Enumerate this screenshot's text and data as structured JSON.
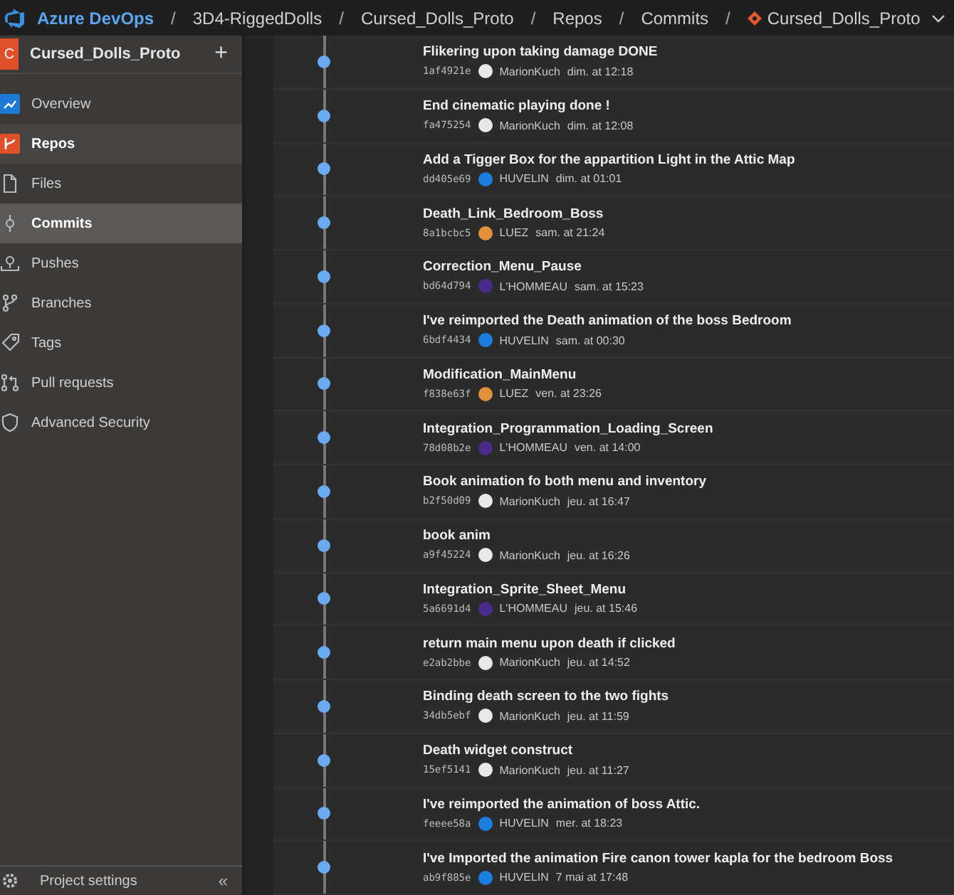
{
  "header": {
    "brand": "Azure DevOps",
    "separator": "/",
    "breadcrumbs": [
      "3D4-RiggedDolls",
      "Cursed_Dolls_Proto",
      "Repos",
      "Commits",
      "Cursed_Dolls_Proto"
    ]
  },
  "sidebar": {
    "project": {
      "initial": "C",
      "name": "Cursed_Dolls_Proto",
      "add": "+"
    },
    "items": [
      {
        "label": "Overview",
        "kind": "overview",
        "selected": false
      },
      {
        "label": "Repos",
        "kind": "repos",
        "selected": false,
        "expanded": true,
        "children": [
          {
            "label": "Files",
            "kind": "files",
            "selected": false
          },
          {
            "label": "Commits",
            "kind": "commits",
            "selected": true
          },
          {
            "label": "Pushes",
            "kind": "pushes",
            "selected": false
          },
          {
            "label": "Branches",
            "kind": "branches",
            "selected": false
          },
          {
            "label": "Tags",
            "kind": "tags",
            "selected": false
          },
          {
            "label": "Pull requests",
            "kind": "pulls",
            "selected": false
          },
          {
            "label": "Advanced Security",
            "kind": "security",
            "selected": false
          }
        ]
      }
    ],
    "footer": {
      "label": "Project settings",
      "collapse": "«"
    }
  },
  "commits": [
    {
      "message": "Flikering upon taking damage DONE",
      "hash": "1af4921e",
      "author": "MarionKuch",
      "color": "#e8e8e8",
      "time": "dim. at 12:18"
    },
    {
      "message": "End cinematic playing done !",
      "hash": "fa475254",
      "author": "MarionKuch",
      "color": "#e8e8e8",
      "time": "dim. at 12:08"
    },
    {
      "message": "Add a Tigger Box for the appartition Light in the Attic Map",
      "hash": "dd405e69",
      "author": "HUVELIN",
      "color": "#1a7ee0",
      "time": "dim. at 01:01"
    },
    {
      "message": "Death_Link_Bedroom_Boss",
      "hash": "8a1bcbc5",
      "author": "LUEZ",
      "color": "#e0913a",
      "time": "sam. at 21:24"
    },
    {
      "message": "Correction_Menu_Pause",
      "hash": "bd64d794",
      "author": "L'HOMMEAU",
      "color": "#4a2a8a",
      "time": "sam. at 15:23"
    },
    {
      "message": "I've reimported the Death animation of the boss Bedroom",
      "hash": "6bdf4434",
      "author": "HUVELIN",
      "color": "#1a7ee0",
      "time": "sam. at 00:30"
    },
    {
      "message": "Modification_MainMenu",
      "hash": "f838e63f",
      "author": "LUEZ",
      "color": "#e0913a",
      "time": "ven. at 23:26"
    },
    {
      "message": "Integration_Programmation_Loading_Screen",
      "hash": "78d08b2e",
      "author": "L'HOMMEAU",
      "color": "#4a2a8a",
      "time": "ven. at 14:00"
    },
    {
      "message": "Book animation fo both menu and inventory",
      "hash": "b2f50d09",
      "author": "MarionKuch",
      "color": "#e8e8e8",
      "time": "jeu. at 16:47"
    },
    {
      "message": "book anim",
      "hash": "a9f45224",
      "author": "MarionKuch",
      "color": "#e8e8e8",
      "time": "jeu. at 16:26"
    },
    {
      "message": "Integration_Sprite_Sheet_Menu",
      "hash": "5a6691d4",
      "author": "L'HOMMEAU",
      "color": "#4a2a8a",
      "time": "jeu. at 15:46"
    },
    {
      "message": "return main menu upon death if clicked",
      "hash": "e2ab2bbe",
      "author": "MarionKuch",
      "color": "#e8e8e8",
      "time": "jeu. at 14:52"
    },
    {
      "message": "Binding death screen to the two fights",
      "hash": "34db5ebf",
      "author": "MarionKuch",
      "color": "#e8e8e8",
      "time": "jeu. at 11:59"
    },
    {
      "message": "Death widget construct",
      "hash": "15ef5141",
      "author": "MarionKuch",
      "color": "#e8e8e8",
      "time": "jeu. at 11:27"
    },
    {
      "message": "I've reimported the animation of boss Attic.",
      "hash": "feeee58a",
      "author": "HUVELIN",
      "color": "#1a7ee0",
      "time": "mer. at 18:23"
    },
    {
      "message": "I've Imported the animation Fire canon tower kapla for the bedroom Boss",
      "hash": "ab9f885e",
      "author": "HUVELIN",
      "color": "#1a7ee0",
      "time": "7 mai at 17:48"
    }
  ]
}
